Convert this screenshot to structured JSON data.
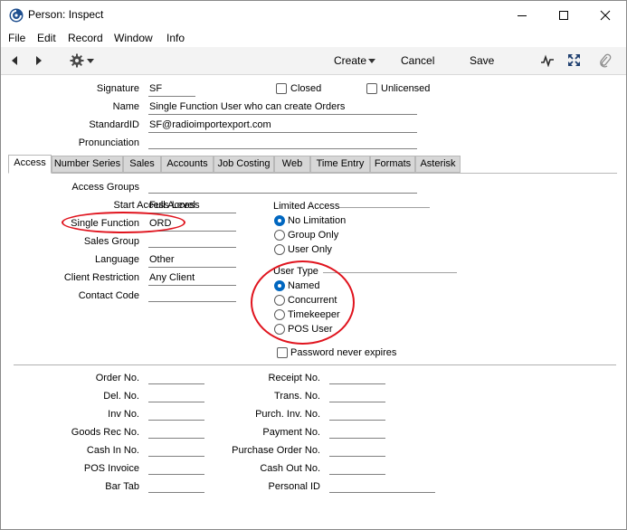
{
  "window": {
    "title": "Person: Inspect"
  },
  "menu": [
    "File",
    "Edit",
    "Record",
    "Window",
    "Info"
  ],
  "toolbar": {
    "create": "Create",
    "cancel": "Cancel",
    "save": "Save"
  },
  "header": {
    "signature_label": "Signature",
    "signature": "SF",
    "name_label": "Name",
    "name": "Single Function User who can create Orders",
    "standardid_label": "StandardID",
    "standardid": "SF@radioimportexport.com",
    "pronunciation_label": "Pronunciation",
    "pronunciation": "",
    "closed_label": "Closed",
    "unlicensed_label": "Unlicensed"
  },
  "tabs": [
    "Access",
    "Number Series",
    "Sales",
    "Accounts",
    "Job Costing",
    "Web",
    "Time Entry",
    "Formats",
    "Asterisk"
  ],
  "access": {
    "access_groups_label": "Access Groups",
    "access_groups": "",
    "start_access_level_label": "Start Access Level",
    "start_access_level": "Full Access",
    "single_function_label": "Single Function",
    "single_function": "ORD",
    "sales_group_label": "Sales Group",
    "sales_group": "",
    "language_label": "Language",
    "language": "Other",
    "client_restriction_label": "Client Restriction",
    "client_restriction": "Any Client",
    "contact_code_label": "Contact Code",
    "contact_code": "",
    "limited_access_title": "Limited Access",
    "limited_access_options": [
      "No Limitation",
      "Group Only",
      "User Only"
    ],
    "user_type_title": "User Type",
    "user_type_options": [
      "Named",
      "Concurrent",
      "Timekeeper",
      "POS User"
    ],
    "password_never_expires_label": "Password never expires"
  },
  "numbers": {
    "left": [
      "Order No.",
      "Del. No.",
      "Inv No.",
      "Goods Rec No.",
      "Cash In No.",
      "POS Invoice",
      "Bar Tab"
    ],
    "right": [
      "Receipt No.",
      "Trans. No.",
      "Purch. Inv. No.",
      "Payment No.",
      "Purchase Order No.",
      "Cash Out No.",
      "Personal ID"
    ]
  },
  "colors": {
    "accent": "#0067c0",
    "highlight": "#e0141e"
  },
  "icons": [
    "app-icon",
    "minimize-icon",
    "maximize-icon",
    "close-icon",
    "back-arrow-icon",
    "forward-arrow-icon",
    "gear-icon",
    "dropdown-icon",
    "pulse-icon",
    "expand-icon",
    "paperclip-icon"
  ]
}
